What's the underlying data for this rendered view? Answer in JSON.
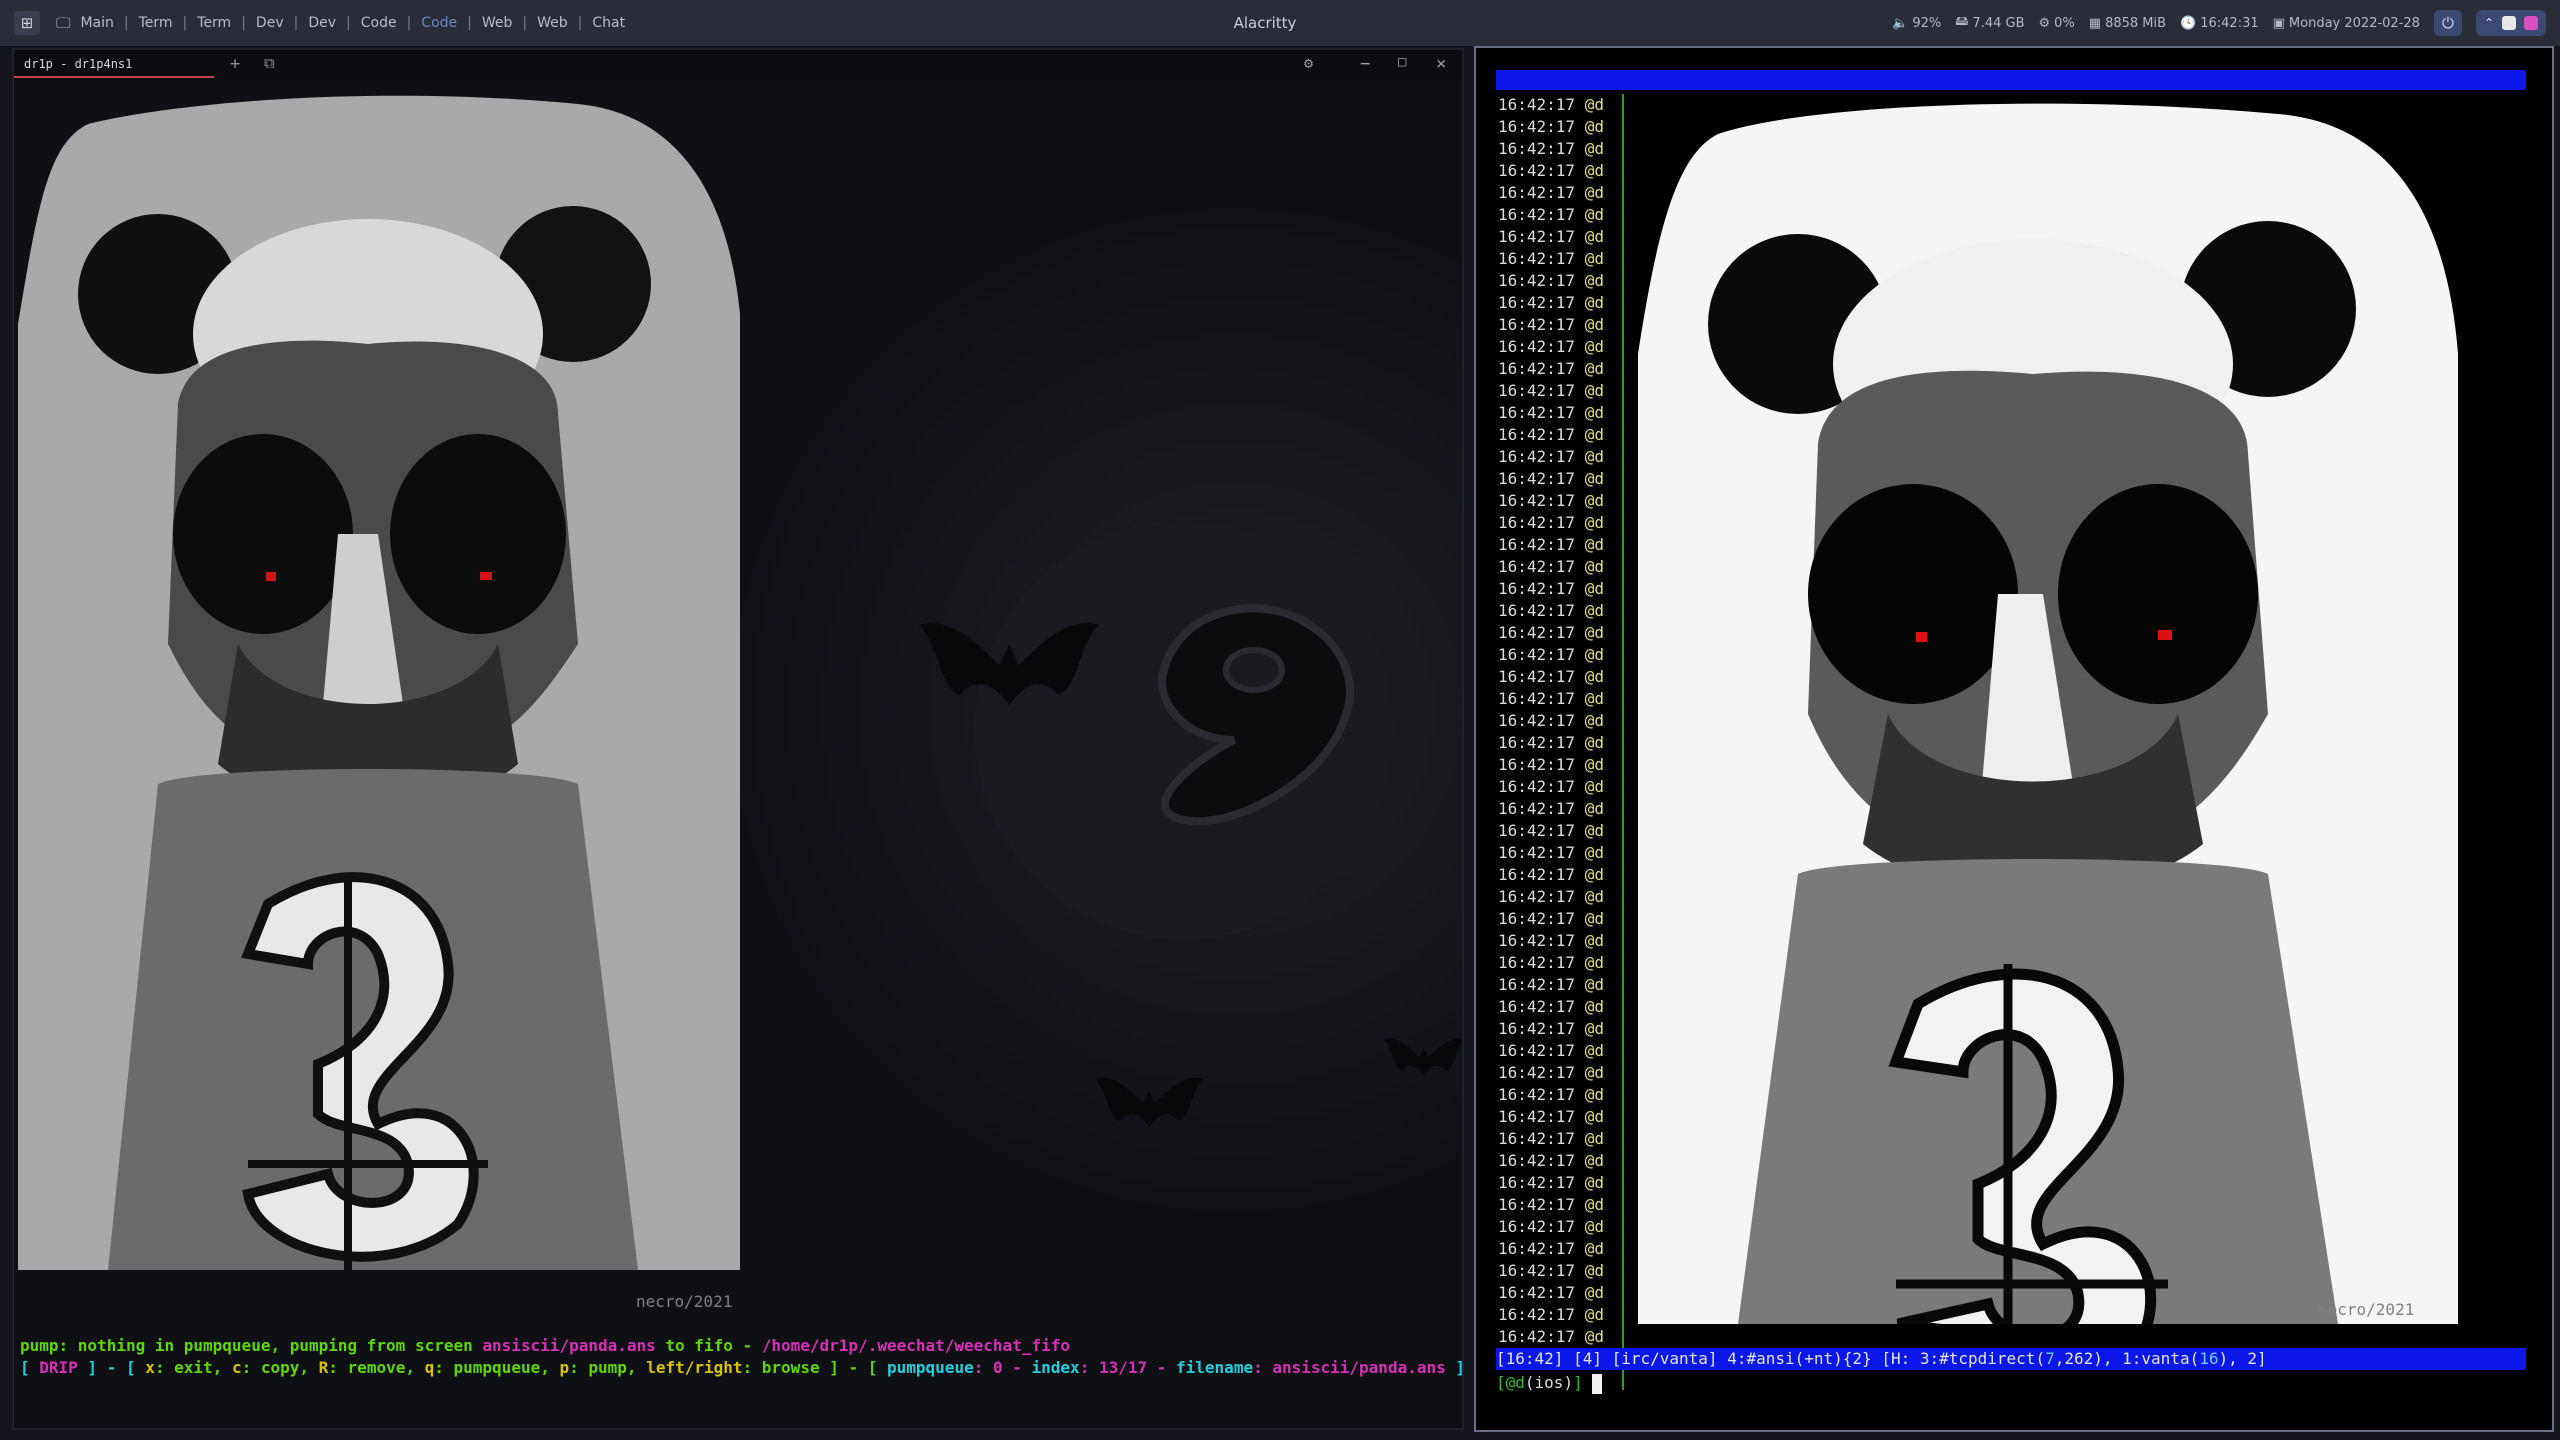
{
  "topbar": {
    "workspaces": [
      "Main",
      "Term",
      "Term",
      "Dev",
      "Dev",
      "Code",
      "Code",
      "Web",
      "Web",
      "Chat"
    ],
    "active_workspace_index": 6,
    "window_title": "Alacritty",
    "volume": "92%",
    "disk": "7.44 GB",
    "cpu": "0%",
    "memory": "8858 MiB",
    "time": "16:42:31",
    "date": "Monday 2022-02-28",
    "icons": {
      "apps": "app-grid-icon",
      "monitor": "monitor-icon",
      "volume": "speaker-icon",
      "disk": "disk-icon",
      "cpu": "cpu-icon",
      "memory": "memory-icon",
      "clock": "clock-icon",
      "calendar": "calendar-icon",
      "power": "power-icon"
    },
    "colors": {
      "bar": "#2a2c37",
      "accent": "#3a4a72",
      "active_ws": "#6a86c4"
    }
  },
  "left_terminal": {
    "tab_label": "dr1p - dr1p4ns1",
    "signature": "necro/2021",
    "line1": {
      "p1": "pump: nothing in pumpqueue, pumping from screen ",
      "p2": "ansiscii/panda.ans",
      "p3": " to fifo - ",
      "p4": "/home/dr1p/.weechat/weechat_fifo"
    },
    "line2": {
      "p1": "[ ",
      "p2": "DRIP",
      "p3": " ] - [ ",
      "p4": "x",
      "p5": ": exit, ",
      "p6": "c",
      "p7": ": copy, ",
      "p8": "R",
      "p9": ": remove, ",
      "p10": "q",
      "p11": ": pumpqueue, ",
      "p12": "p",
      "p13": ": pump, ",
      "p14": "left/right",
      "p15": ": browse ] - [ ",
      "p16": "pumpqueue",
      "p17": ": 0 - ",
      "p18": "index",
      "p19": ": 13/17 - ",
      "p20": "filename",
      "p21": ": ",
      "p22": "ansiscii/panda.ans",
      "p23": " ]"
    }
  },
  "right_terminal": {
    "timestamp": "16:42:17",
    "nick": "@d",
    "line_count": 57,
    "signature": "necro/2021",
    "status": {
      "p1": "[16:42] [4] [irc/vanta] 4:#ansi(+nt){2} [H: 3:#tcpdirect(",
      "p2": "7",
      "p3": ",262), 1:vanta(",
      "p4": "16",
      "p5": "), 2]"
    },
    "input": {
      "open": "[",
      "nick": "@d",
      "chan": "(ios)",
      "close": "]"
    },
    "colors": {
      "bar": "#0a17e8",
      "separator": "#2f9a2f"
    }
  }
}
